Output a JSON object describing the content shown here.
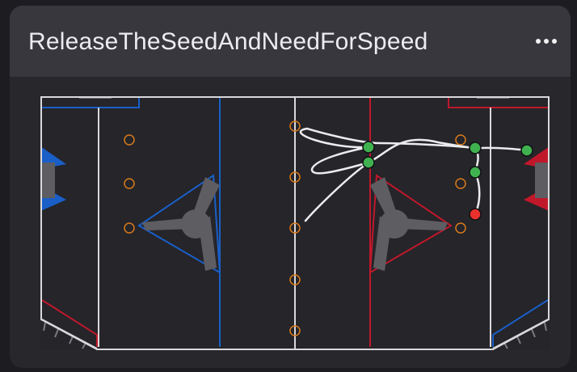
{
  "card": {
    "title": "ReleaseTheSeedAndNeedForSpeed",
    "menu_icon": "more-horizontal-icon"
  },
  "field": {
    "colors": {
      "background": "#25252a",
      "boundary": "#d9d9dc",
      "blue_alliance": "#1a5fc8",
      "red_alliance": "#c0182a",
      "hub": "#5d5d62",
      "seed_marker": "#d97a1a",
      "path": "#ececee",
      "waypoint": "#3fb24f",
      "end_point": "#e8302c"
    },
    "marker_count": 11,
    "waypoint_count": 6,
    "end_point_count": 1
  }
}
